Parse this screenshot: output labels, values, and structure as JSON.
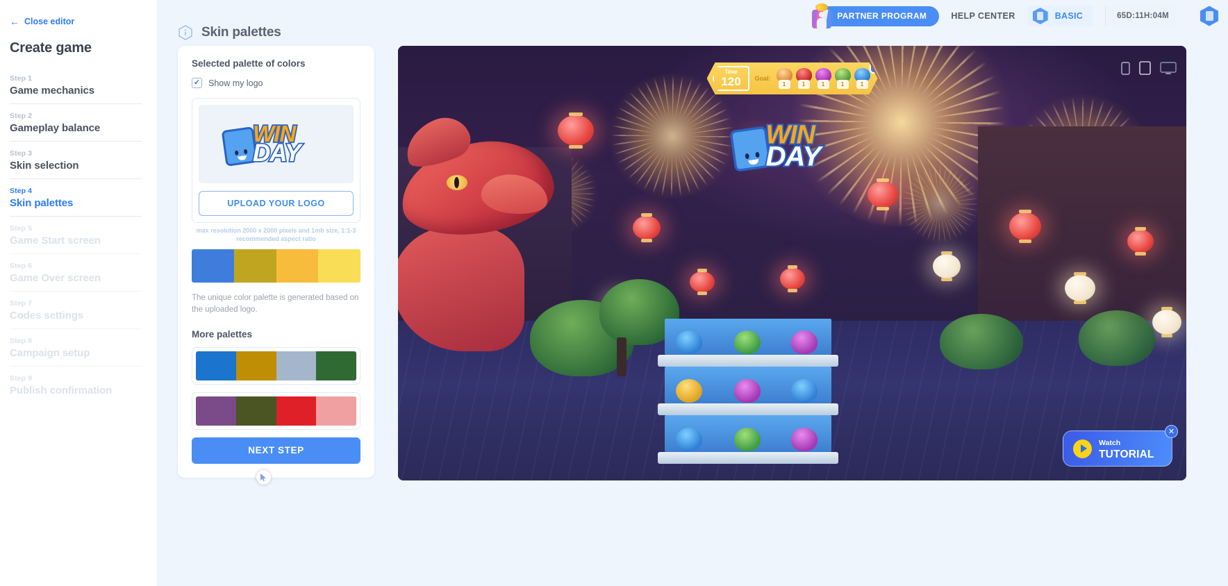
{
  "sidebar": {
    "close_editor": "Close editor",
    "title": "Create game",
    "steps": [
      {
        "num": "Step 1",
        "label": "Game mechanics",
        "state": "done"
      },
      {
        "num": "Step 2",
        "label": "Gameplay balance",
        "state": "done"
      },
      {
        "num": "Step 3",
        "label": "Skin selection",
        "state": "done"
      },
      {
        "num": "Step 4",
        "label": "Skin palettes",
        "state": "active"
      },
      {
        "num": "Step 5",
        "label": "Game Start screen",
        "state": "future"
      },
      {
        "num": "Step 6",
        "label": "Game Over screen",
        "state": "future"
      },
      {
        "num": "Step 7",
        "label": "Codes settings",
        "state": "future"
      },
      {
        "num": "Step 8",
        "label": "Campaign setup",
        "state": "future"
      },
      {
        "num": "Step 9",
        "label": "Publish confirmation",
        "state": "future"
      }
    ]
  },
  "header": {
    "partner_program": "PARTNER PROGRAM",
    "help_center": "HELP CENTER",
    "plan": "BASIC",
    "timer": "65D:11H:04M"
  },
  "main": {
    "title": "Skin palettes"
  },
  "panel": {
    "selected_heading": "Selected palette of colors",
    "show_my_logo": "Show my logo",
    "logo_text_top": "WIN",
    "logo_text_bottom": "DAY",
    "upload_button": "UPLOAD YOUR LOGO",
    "upload_hint": "max resolution 2000 x 2000 pixels and 1mb size, 1:1-3 recommended aspect ratio",
    "selected_palette": [
      "#3f7ddd",
      "#c0a521",
      "#f7bc3b",
      "#f9dd56"
    ],
    "note": "The unique color palette is generated based on the uploaded logo.",
    "more_heading": "More palettes",
    "more_palettes": [
      [
        "#1b74cd",
        "#bf8e05",
        "#a3b6cb",
        "#2f6a33"
      ],
      [
        "#7b4a88",
        "#4b5524",
        "#e02028",
        "#f0a0a0"
      ]
    ],
    "next_step": "NEXT STEP"
  },
  "preview": {
    "hud": {
      "time_label": "Time",
      "time_value": "120",
      "goal_label": "Goal:",
      "goal_items": [
        {
          "count": "1",
          "color_class": "c1"
        },
        {
          "count": "1",
          "color_class": "c2"
        },
        {
          "count": "1",
          "color_class": "c3"
        },
        {
          "count": "1",
          "color_class": "c4"
        },
        {
          "count": "1",
          "color_class": "c5"
        }
      ],
      "close": "✕"
    },
    "game_logo_top": "WIN",
    "game_logo_bottom": "DAY",
    "tutorial": {
      "watch": "Watch",
      "tutorial": "TUTORIAL",
      "close": "✕"
    }
  },
  "colors": {
    "accent": "#3d8bf5",
    "text_dark": "#3b4250",
    "muted": "#b9c0cb",
    "bg": "#eef5fd"
  }
}
